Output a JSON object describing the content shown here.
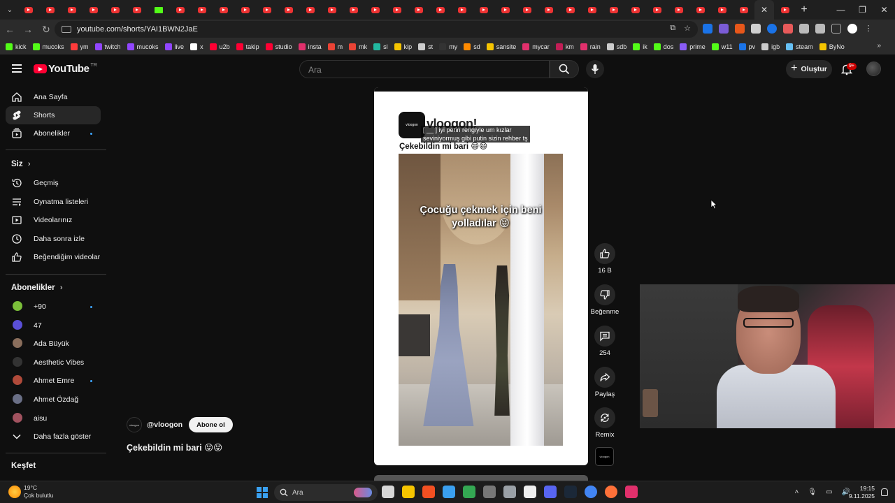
{
  "browser": {
    "url": "youtube.com/shorts/YAI1BWN2JaE",
    "bookmarks": [
      {
        "label": "kick",
        "color": "#53fc18"
      },
      {
        "label": "mucoks",
        "color": "#53fc18"
      },
      {
        "label": "ym",
        "color": "#ff3b3b"
      },
      {
        "label": "twitch",
        "color": "#9146ff"
      },
      {
        "label": "mucoks",
        "color": "#9146ff"
      },
      {
        "label": "live",
        "color": "#9146ff"
      },
      {
        "label": "x",
        "color": "#ffffff"
      },
      {
        "label": "u2b",
        "color": "#ff0033"
      },
      {
        "label": "takip",
        "color": "#ff0033"
      },
      {
        "label": "studio",
        "color": "#ff0033"
      },
      {
        "label": "insta",
        "color": "#e1306c"
      },
      {
        "label": "m",
        "color": "#ea4335"
      },
      {
        "label": "mk",
        "color": "#ea4335"
      },
      {
        "label": "sl",
        "color": "#22b8a0"
      },
      {
        "label": "kip",
        "color": "#f5c400"
      },
      {
        "label": "st",
        "color": "#cccccc"
      },
      {
        "label": "my",
        "color": "#333333"
      },
      {
        "label": "sd",
        "color": "#ff8a00"
      },
      {
        "label": "sansite",
        "color": "#f5c400"
      },
      {
        "label": "mycar",
        "color": "#e1306c"
      },
      {
        "label": "km",
        "color": "#c21e56"
      },
      {
        "label": "rain",
        "color": "#e1306c"
      },
      {
        "label": "sdb",
        "color": "#cccccc"
      },
      {
        "label": "ik",
        "color": "#53fc18"
      },
      {
        "label": "dos",
        "color": "#53fc18"
      },
      {
        "label": "prime",
        "color": "#8a5cf6"
      },
      {
        "label": "w11",
        "color": "#53fc18"
      },
      {
        "label": "pv",
        "color": "#1a73e8"
      },
      {
        "label": "igb",
        "color": "#cccccc"
      },
      {
        "label": "steam",
        "color": "#66c0f4"
      },
      {
        "label": "ByNo",
        "color": "#f5c400"
      }
    ]
  },
  "header": {
    "logo_text": "YouTube",
    "logo_country": "TR",
    "search_placeholder": "Ara",
    "create_label": "Oluştur",
    "notif_badge": "9+"
  },
  "sidebar": {
    "main": [
      {
        "label": "Ana Sayfa",
        "icon": "home-icon"
      },
      {
        "label": "Shorts",
        "icon": "shorts-icon"
      },
      {
        "label": "Abonelikler",
        "icon": "subscriptions-icon"
      }
    ],
    "you_heading": "Siz",
    "you": [
      {
        "label": "Geçmiş",
        "icon": "history-icon"
      },
      {
        "label": "Oynatma listeleri",
        "icon": "playlists-icon"
      },
      {
        "label": "Videolarınız",
        "icon": "your-videos-icon"
      },
      {
        "label": "Daha sonra izle",
        "icon": "watch-later-icon"
      },
      {
        "label": "Beğendiğim videolar",
        "icon": "liked-icon"
      }
    ],
    "subs_heading": "Abonelikler",
    "subscriptions": [
      {
        "label": "+90",
        "color": "#7bbf3a",
        "new": true
      },
      {
        "label": "47",
        "color": "#5a4fd8",
        "new": false
      },
      {
        "label": "Ada Büyük",
        "color": "#8a6e5c",
        "new": false
      },
      {
        "label": "Aesthetic Vibes",
        "color": "#333333",
        "new": false
      },
      {
        "label": "Ahmet Emre",
        "color": "#b04a3a",
        "new": true
      },
      {
        "label": "Ahmet Özdağ",
        "color": "#6a6f86",
        "new": false
      },
      {
        "label": "aisu",
        "color": "#a1525f",
        "new": false
      }
    ],
    "show_more": "Daha fazla göster",
    "explore_heading": "Keşfet"
  },
  "short": {
    "inner_channel_name": "vloogon!",
    "inner_avatar_text": "vloogon",
    "caption_line1": "[ __ ] iyi perin rengiyle um kızlar",
    "caption_line2": "seviniyormuş gibi putin sizin rehber tş",
    "inner_title": "Çekebildin mi bari 😄😄",
    "overlay_text_line1": "Çocuğu çekmek için beni",
    "overlay_text_line2": "yolladılar 😝",
    "channel_handle": "@vloogon",
    "subscribe_label": "Abone ol",
    "title": "Çekebildin mi bari 😝😝"
  },
  "actions": {
    "like_count": "16 B",
    "dislike_label": "Beğenme",
    "comment_count": "254",
    "share_label": "Paylaş",
    "remix_label": "Remix"
  },
  "taskbar": {
    "temperature": "19°C",
    "weather": "Çok bulutlu",
    "search_label": "Ara",
    "time": "19:15",
    "date": "9.11.2025",
    "app_colors": [
      "#d7d7d7",
      "#f5c400",
      "#f25022",
      "#3aa0f0",
      "#34a853",
      "#777777",
      "#9aa0a6",
      "#eeeeee",
      "#5865f2",
      "#1b2838",
      "#4285f4",
      "#ff7139",
      "#e1306c"
    ]
  }
}
